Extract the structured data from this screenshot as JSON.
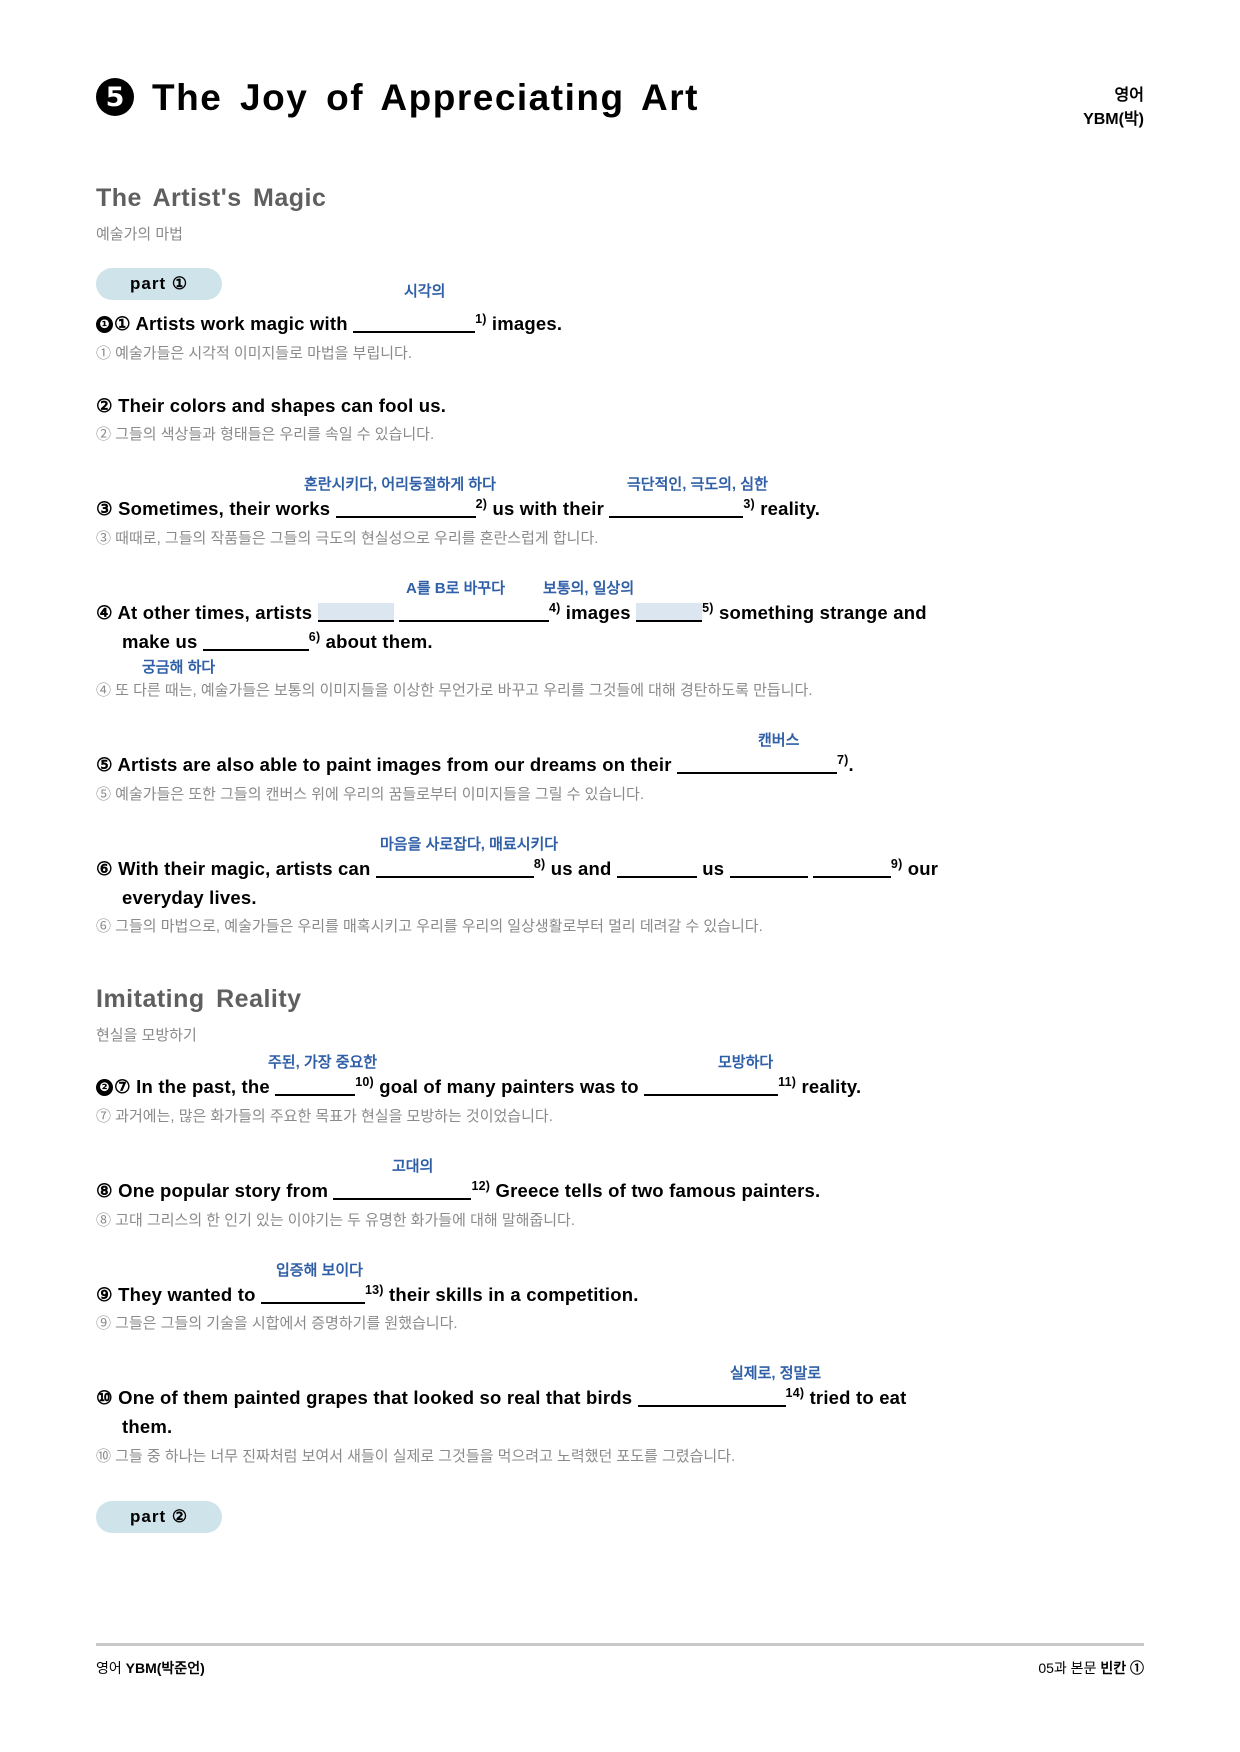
{
  "header": {
    "unit_number": "5",
    "title": "The Joy of Appreciating Art",
    "subject": "영어",
    "publisher": "YBM(박)"
  },
  "sections": [
    {
      "title": "The Artist's Magic",
      "subtitle": "예술가의 마법",
      "part_pill": "part ①"
    },
    {
      "title": "Imitating Reality",
      "subtitle": "현실을 모방하기",
      "part_pill": "part ②"
    }
  ],
  "sentences": {
    "s1": {
      "hint": "시각의",
      "marker": "❶",
      "num": "①",
      "en_1": "Artists  work  magic  with",
      "fn": "1)",
      "en_2": "images.",
      "ko": "① 예술가들은 시각적 이미지들로 마법을 부립니다."
    },
    "s2": {
      "num": "②",
      "en": "Their  colors  and  shapes  can  fool  us.",
      "ko": "② 그들의 색상들과 형태들은 우리를 속일 수 있습니다."
    },
    "s3": {
      "hint_a": "혼란시키다, 어리둥절하게 하다",
      "hint_b": "극단적인, 극도의, 심한",
      "num": "③",
      "en_1": "Sometimes,  their  works",
      "fn_a": "2)",
      "en_2": "us  with  their",
      "fn_b": "3)",
      "en_3": "reality.",
      "ko": "③ 때때로, 그들의 작품들은 그들의 극도의 현실성으로 우리를 혼란스럽게 합니다."
    },
    "s4": {
      "hint_a": "A를 B로 바꾸다",
      "hint_b": "보통의, 일상의",
      "hint_c": "궁금해 하다",
      "num": "④",
      "en_1": "At  other  times,  artists",
      "fn_a": "4)",
      "en_2": "images",
      "fn_b": "5)",
      "en_3": "something  strange  and",
      "en_4": "make  us",
      "fn_c": "6)",
      "en_5": "about  them.",
      "ko": "④ 또 다른 때는, 예술가들은 보통의 이미지들을 이상한 무언가로 바꾸고 우리를 그것들에 대해 경탄하도록 만듭니다."
    },
    "s5": {
      "hint": "캔버스",
      "num": "⑤",
      "en_1": "Artists  are  also  able  to  paint  images  from  our  dreams  on  their",
      "fn": "7)",
      "en_2": ".",
      "ko": "⑤ 예술가들은 또한 그들의 캔버스 위에 우리의 꿈들로부터 이미지들을 그릴 수 있습니다."
    },
    "s6": {
      "hint": "마음을 사로잡다, 매료시키다",
      "num": "⑥",
      "en_1": "With  their  magic,  artists  can",
      "fn_a": "8)",
      "en_2": "us  and",
      "en_3": "us",
      "fn_b": "9)",
      "en_4": "our",
      "en_5": "everyday  lives.",
      "ko": "⑥ 그들의 마법으로, 예술가들은 우리를 매혹시키고 우리를 우리의 일상생활로부터 멀리 데려갈 수 있습니다."
    },
    "s7": {
      "hint_a": "주된, 가장 중요한",
      "hint_b": "모방하다",
      "marker": "❷",
      "num": "⑦",
      "en_1": "In  the  past,  the",
      "fn_a": "10)",
      "en_2": "goal  of  many  painters  was  to",
      "fn_b": "11)",
      "en_3": "reality.",
      "ko": "⑦ 과거에는, 많은 화가들의 주요한 목표가 현실을 모방하는 것이었습니다."
    },
    "s8": {
      "hint": "고대의",
      "num": "⑧",
      "en_1": "One  popular  story  from",
      "fn": "12)",
      "en_2": "Greece  tells  of  two  famous  painters.",
      "ko": "⑧ 고대 그리스의 한 인기 있는 이야기는 두 유명한 화가들에 대해 말해줍니다."
    },
    "s9": {
      "hint": "입증해 보이다",
      "num": "⑨",
      "en_1": "They  wanted  to",
      "fn": "13)",
      "en_2": "their  skills  in  a  competition.",
      "ko": "⑨ 그들은 그들의 기술을 시합에서 증명하기를 원했습니다."
    },
    "s10": {
      "hint": "실제로, 정말로",
      "num": "⑩",
      "en_1": "One  of  them  painted  grapes  that  looked  so  real  that  birds",
      "fn": "14)",
      "en_2": "tried  to  eat",
      "en_3": "them.",
      "ko": "⑩ 그들 중 하나는 너무 진짜처럼 보여서 새들이 실제로 그것들을 먹으려고 노력했던 포도를 그렸습니다."
    }
  },
  "footer": {
    "left_plain": "영어 ",
    "left_bold": "YBM(박준언)",
    "right_plain": "05과 본문 ",
    "right_bold": "빈칸 ①"
  },
  "colors": {
    "hint_blue": "#2f5fa6",
    "pill_bg": "#cfe4ea",
    "translation_grey": "#8a8a8a",
    "section_grey": "#5f5f5f",
    "blank_highlight": "#dbe6f1"
  }
}
